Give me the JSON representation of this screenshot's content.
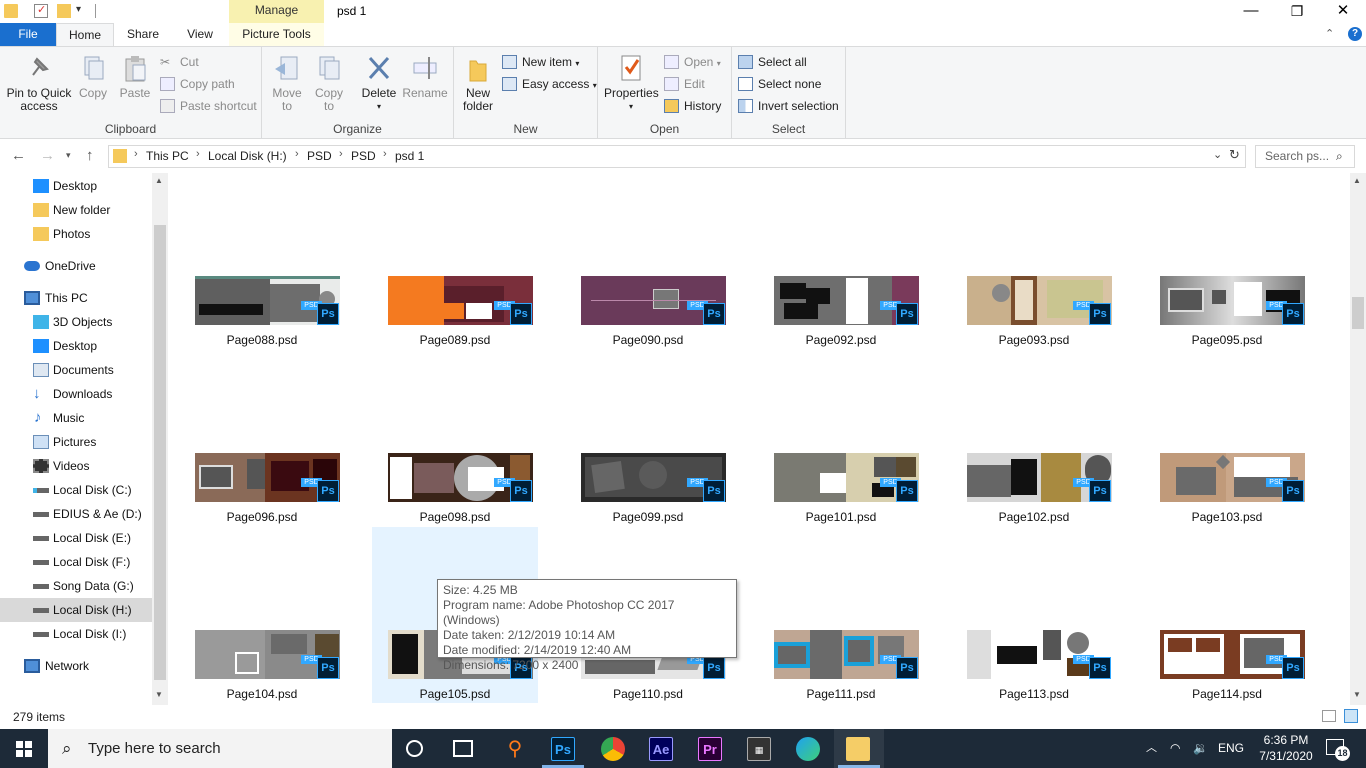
{
  "window": {
    "title": "psd 1",
    "manage_tab": "Manage",
    "controls": {
      "minimize": "—",
      "maximize": "❐",
      "close": "✕"
    }
  },
  "ribbon_tabs": [
    "File",
    "Home",
    "Share",
    "View",
    "Picture Tools"
  ],
  "ribbon": {
    "clipboard": {
      "label": "Clipboard",
      "pin_line1": "Pin to Quick",
      "pin_line2": "access",
      "copy": "Copy",
      "paste": "Paste",
      "cut": "Cut",
      "copy_path": "Copy path",
      "paste_shortcut": "Paste shortcut"
    },
    "organize": {
      "label": "Organize",
      "move_to_1": "Move",
      "move_to_2": "to",
      "copy_to_1": "Copy",
      "copy_to_2": "to",
      "delete": "Delete",
      "rename": "Rename"
    },
    "new": {
      "label": "New",
      "new_folder_1": "New",
      "new_folder_2": "folder",
      "new_item": "New item",
      "easy_access": "Easy access"
    },
    "open": {
      "label": "Open",
      "properties": "Properties",
      "open": "Open",
      "edit": "Edit",
      "history": "History"
    },
    "select": {
      "label": "Select",
      "select_all": "Select all",
      "select_none": "Select none",
      "invert": "Invert selection"
    }
  },
  "address": {
    "crumbs": [
      "This PC",
      "Local Disk (H:)",
      "PSD",
      "PSD",
      "psd 1"
    ],
    "search_placeholder": "Search ps..."
  },
  "nav_items": [
    {
      "label": "Desktop",
      "icon": "desktop-icon"
    },
    {
      "label": "New folder",
      "icon": "folder-icon"
    },
    {
      "label": "Photos",
      "icon": "folder-icon"
    },
    {
      "label": "OneDrive",
      "icon": "cloud-icon"
    },
    {
      "label": "This PC",
      "icon": "pc-icon"
    },
    {
      "label": "3D Objects",
      "icon": "cube-icon"
    },
    {
      "label": "Desktop",
      "icon": "desktop-icon"
    },
    {
      "label": "Documents",
      "icon": "documents-icon"
    },
    {
      "label": "Downloads",
      "icon": "downloads-icon"
    },
    {
      "label": "Music",
      "icon": "music-icon"
    },
    {
      "label": "Pictures",
      "icon": "pictures-icon"
    },
    {
      "label": "Videos",
      "icon": "videos-icon"
    },
    {
      "label": "Local Disk (C:)",
      "icon": "drive-icon"
    },
    {
      "label": "EDIUS & Ae (D:)",
      "icon": "drive-icon"
    },
    {
      "label": "Local Disk (E:)",
      "icon": "drive-icon"
    },
    {
      "label": "Local Disk (F:)",
      "icon": "drive-icon"
    },
    {
      "label": "Song Data (G:)",
      "icon": "drive-icon"
    },
    {
      "label": "Local Disk (H:)",
      "icon": "drive-icon"
    },
    {
      "label": "Local Disk (I:)",
      "icon": "drive-icon"
    },
    {
      "label": "Network",
      "icon": "network-icon"
    }
  ],
  "files": [
    "Page088.psd",
    "Page089.psd",
    "Page090.psd",
    "Page092.psd",
    "Page093.psd",
    "Page095.psd",
    "Page096.psd",
    "Page098.psd",
    "Page099.psd",
    "Page101.psd",
    "Page102.psd",
    "Page103.psd",
    "Page104.psd",
    "Page105.psd",
    "Page110.psd",
    "Page111.psd",
    "Page113.psd",
    "Page114.psd"
  ],
  "badge": {
    "ps": "Ps",
    "psd": "PSD"
  },
  "tooltip": {
    "size": "Size: 4.25 MB",
    "program": "Program name: Adobe Photoshop CC 2017 (Windows)",
    "taken": "Date taken: 2/12/2019 10:14 AM",
    "modified": "Date modified: 2/14/2019 12:40 AM",
    "dimensions": "Dimensions: 7200 x 2400"
  },
  "status": {
    "count": "279 items"
  },
  "taskbar": {
    "search_placeholder": "Type here to search",
    "apps": {
      "ps": "Ps",
      "ae": "Ae",
      "pr": "Pr"
    },
    "lang": "ENG",
    "time": "6:36 PM",
    "date": "7/31/2020",
    "notifications": "18"
  }
}
